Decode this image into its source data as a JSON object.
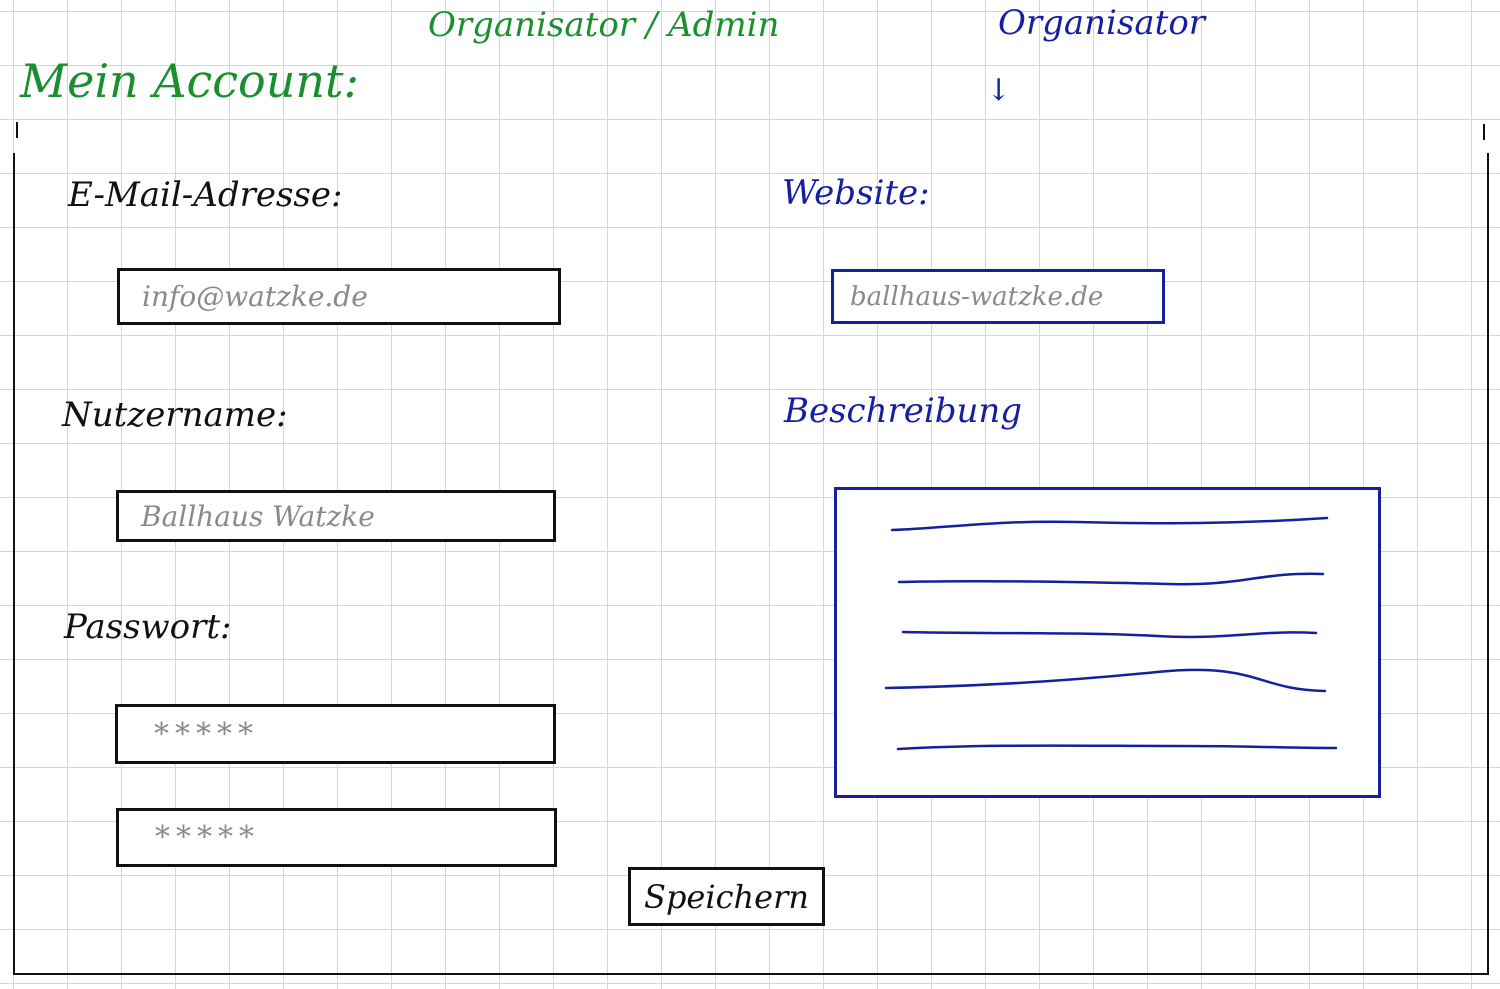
{
  "header": {
    "title": "Mein Account:",
    "role_organizer_admin": "Organisator / Admin",
    "role_organizer": "Organisator",
    "role_arrow": "↓"
  },
  "form": {
    "email": {
      "label": "E-Mail-Adresse:",
      "value": "info@watzke.de"
    },
    "username": {
      "label": "Nutzername:",
      "value": "Ballhaus Watzke"
    },
    "password": {
      "label": "Passwort:",
      "value": "*****",
      "confirm_value": "*****"
    },
    "website": {
      "label": "Website:",
      "value": "ballhaus-watzke.de"
    },
    "description": {
      "label": "Beschreibung"
    },
    "save_label": "Speichern"
  },
  "colors": {
    "admin_annotation": "#1a8f2e",
    "organizer_annotation": "#1520a0",
    "ink": "#111111",
    "placeholder": "#8a8a8a"
  }
}
